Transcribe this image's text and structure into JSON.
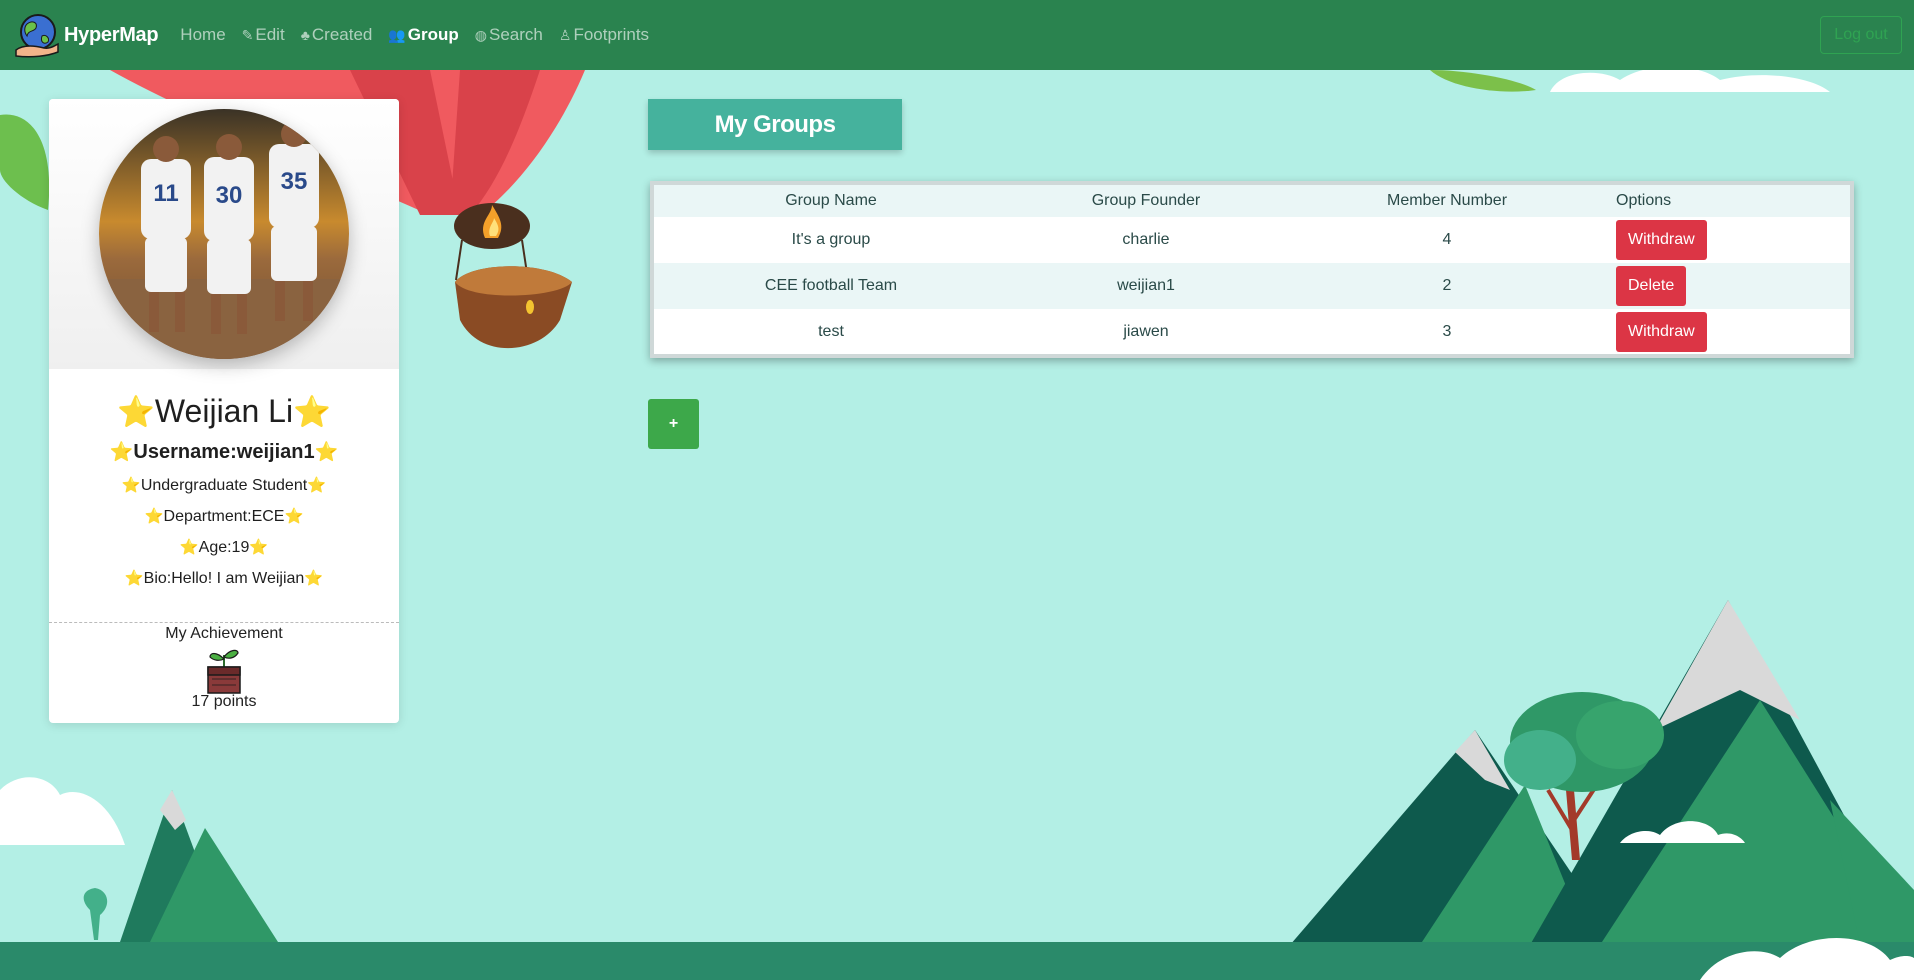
{
  "nav": {
    "brand": "HyperMap",
    "links": [
      {
        "label": "Home",
        "icon": "home"
      },
      {
        "label": "Edit",
        "icon": "edit-icon"
      },
      {
        "label": "Created",
        "icon": "tree-icon"
      },
      {
        "label": "Group",
        "icon": "group-icon"
      },
      {
        "label": "Search",
        "icon": "globe-icon"
      },
      {
        "label": "Footprints",
        "icon": "person-icon"
      }
    ],
    "logout": "Log out"
  },
  "profile": {
    "name": "Weijian Li",
    "username": "Username:weijian1",
    "role": "Undergraduate Student",
    "department": "Department:ECE",
    "age": "Age:19",
    "bio": "Bio:Hello! I am Weijian",
    "achievement_title": "My Achievement",
    "points": "17 points",
    "avatar_numbers": [
      "11",
      "30",
      "35"
    ]
  },
  "groups": {
    "title": "My Groups",
    "headers": [
      "Group Name",
      "Group Founder",
      "Member Number",
      "Options"
    ],
    "rows": [
      {
        "name": "It's a group",
        "founder": "charlie",
        "members": "4",
        "action": "Withdraw"
      },
      {
        "name": "CEE football Team",
        "founder": "weijian1",
        "members": "2",
        "action": "Delete"
      },
      {
        "name": "test",
        "founder": "jiawen",
        "members": "3",
        "action": "Withdraw"
      }
    ],
    "add_label": "+"
  },
  "colors": {
    "navbar": "#2a834f",
    "background": "#b3efe5",
    "title_bg": "#45b29d",
    "danger": "#dc3545",
    "add": "#3da84a"
  }
}
